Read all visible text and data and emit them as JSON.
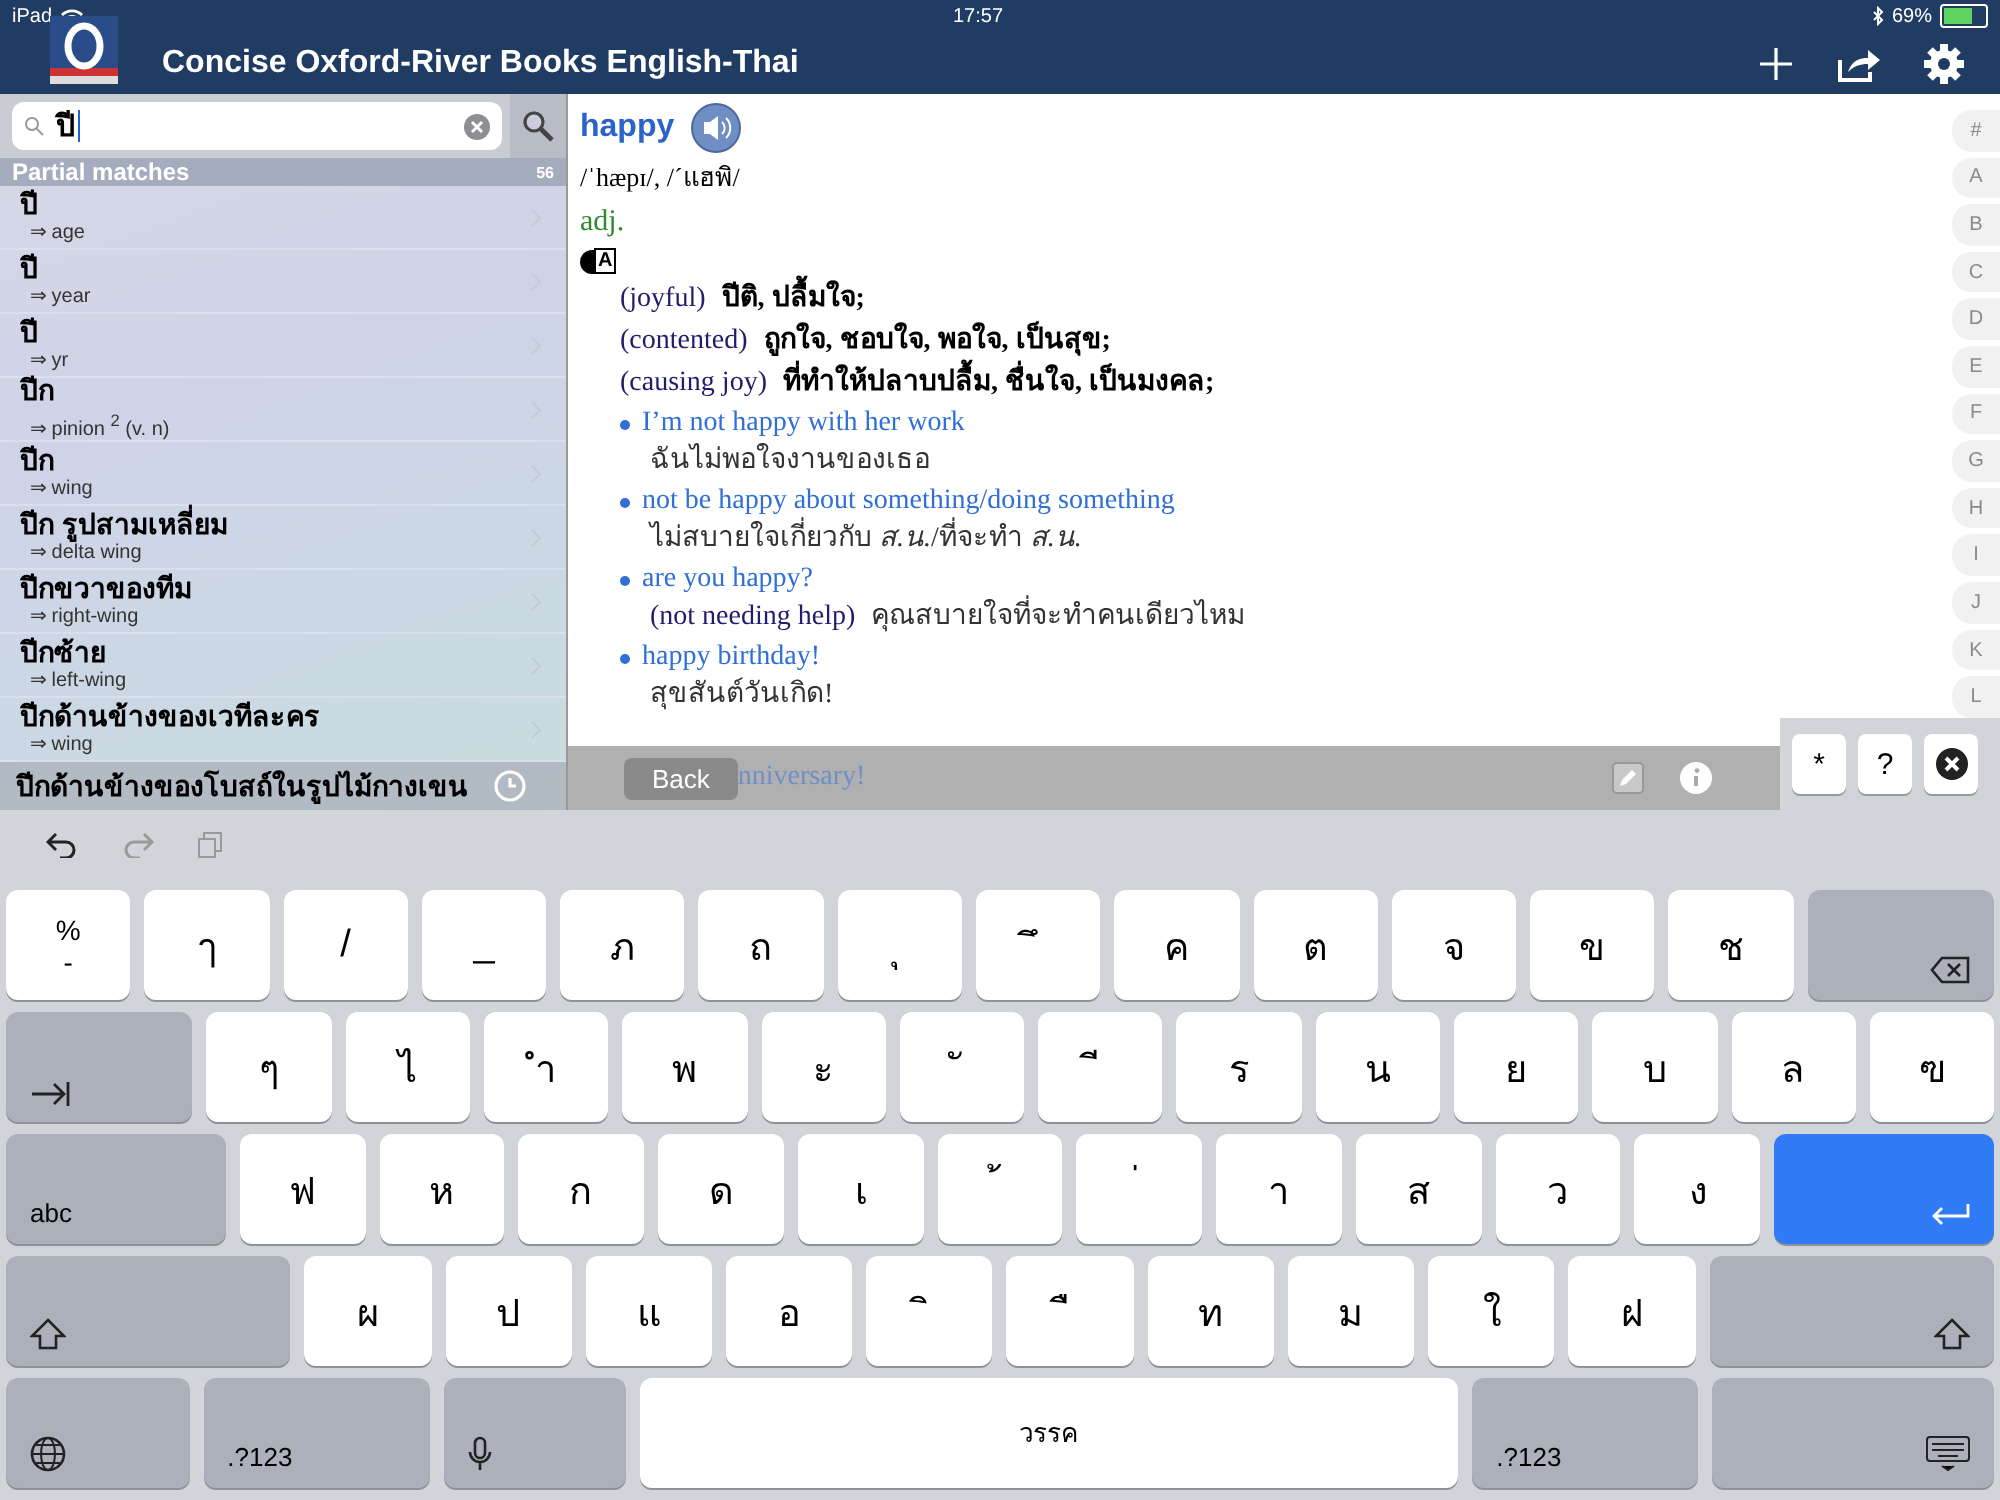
{
  "status_bar": {
    "device": "iPad",
    "time": "17:57",
    "battery": "69%"
  },
  "header": {
    "title": "Concise Oxford-River Books English-Thai"
  },
  "search": {
    "value": "ปี"
  },
  "results": {
    "heading": "Partial matches",
    "count": "56",
    "items": [
      {
        "headword": "ปี",
        "gloss": "⇒ age"
      },
      {
        "headword": "ปี",
        "gloss": "⇒ year"
      },
      {
        "headword": "ปี",
        "gloss": "⇒ yr"
      },
      {
        "headword": "ปีก",
        "gloss": "⇒ pinion $^{2}$ (v. n)"
      },
      {
        "headword": "ปีก",
        "gloss": "⇒ wing"
      },
      {
        "headword": "ปีก รูปสามเหลี่ยม",
        "gloss": "⇒ delta wing"
      },
      {
        "headword": "ปีกขวาของทีม",
        "gloss": "⇒ right-wing"
      },
      {
        "headword": "ปีกซ้าย",
        "gloss": "⇒ left-wing"
      },
      {
        "headword": "ปีกด้านข้างของเวทีละคร",
        "gloss": "⇒ wing"
      }
    ],
    "last_item": "ปีกด้านข้างของโบสถ์ในรูปไม้กางเขน"
  },
  "entry": {
    "headword": "happy",
    "pronunciation": "/ˈhæpɪ/, /ˊแฮพิ/",
    "pos": "adj.",
    "register_mark": "A",
    "senses": [
      {
        "label": "(joyful)",
        "text": "ปีติ, ปลื้มใจ;"
      },
      {
        "label": "(contented)",
        "text": "ถูกใจ, ชอบใจ, พอใจ, เป็นสุข;"
      },
      {
        "label": "(causing joy)",
        "text": "ที่ทำให้ปลาบปลื้ม, ชื่นใจ, เป็นมงคล;"
      }
    ],
    "examples": [
      {
        "text": "I’m not happy with her work",
        "translation": "ฉันไม่พอใจงานของเธอ"
      },
      {
        "text": "not be happy about something/doing something",
        "translation": "ไม่สบายใจเกี่ยวกับ *ส.น.*/ที่จะทำ *ส.น.*"
      },
      {
        "text": "are you happy?",
        "note": "(not needing help)",
        "translation": "คุณสบายใจที่จะทำคนเดียวไหม"
      },
      {
        "text": "happy birthday!",
        "translation": "สุขสันต์วันเกิด!"
      }
    ],
    "cut_example": "nniversary!"
  },
  "index_letters": [
    "#",
    "A",
    "B",
    "C",
    "D",
    "E",
    "F",
    "G",
    "H",
    "I",
    "J",
    "K",
    "L"
  ],
  "toolbar": {
    "back": "Back"
  },
  "accessory_keys": [
    {
      "kind": "char",
      "label": "*"
    },
    {
      "kind": "char",
      "label": "?"
    },
    {
      "kind": "clear"
    }
  ],
  "keyboard": {
    "rows": [
      [
        {
          "kind": "char",
          "label": "%",
          "sub": "-"
        },
        {
          "kind": "char",
          "label": "ๅ"
        },
        {
          "kind": "char",
          "label": "/"
        },
        {
          "kind": "char",
          "label": "_"
        },
        {
          "kind": "char",
          "label": "ภ"
        },
        {
          "kind": "char",
          "label": "ถ"
        },
        {
          "kind": "char",
          "label": "ุ"
        },
        {
          "kind": "char",
          "label": "ึ"
        },
        {
          "kind": "char",
          "label": "ค"
        },
        {
          "kind": "char",
          "label": "ต"
        },
        {
          "kind": "char",
          "label": "จ"
        },
        {
          "kind": "char",
          "label": "ข"
        },
        {
          "kind": "char",
          "label": "ช"
        },
        {
          "kind": "delete"
        }
      ],
      [
        {
          "kind": "tab"
        },
        {
          "kind": "char",
          "label": "ๆ"
        },
        {
          "kind": "char",
          "label": "ไ"
        },
        {
          "kind": "char",
          "label": "ำ"
        },
        {
          "kind": "char",
          "label": "พ"
        },
        {
          "kind": "char",
          "label": "ะ"
        },
        {
          "kind": "char",
          "label": "ั"
        },
        {
          "kind": "char",
          "label": "ี"
        },
        {
          "kind": "char",
          "label": "ร"
        },
        {
          "kind": "char",
          "label": "น"
        },
        {
          "kind": "char",
          "label": "ย"
        },
        {
          "kind": "char",
          "label": "บ"
        },
        {
          "kind": "char",
          "label": "ล"
        },
        {
          "kind": "char",
          "label": "ฃ"
        }
      ],
      [
        {
          "kind": "abc",
          "label": "abc"
        },
        {
          "kind": "char",
          "label": "ฟ"
        },
        {
          "kind": "char",
          "label": "ห"
        },
        {
          "kind": "char",
          "label": "ก"
        },
        {
          "kind": "char",
          "label": "ด"
        },
        {
          "kind": "char",
          "label": "เ"
        },
        {
          "kind": "char",
          "label": "้"
        },
        {
          "kind": "char",
          "label": "่"
        },
        {
          "kind": "char",
          "label": "า"
        },
        {
          "kind": "char",
          "label": "ส"
        },
        {
          "kind": "char",
          "label": "ว"
        },
        {
          "kind": "char",
          "label": "ง"
        },
        {
          "kind": "return"
        }
      ],
      [
        {
          "kind": "shift"
        },
        {
          "kind": "char",
          "label": "ผ"
        },
        {
          "kind": "char",
          "label": "ป"
        },
        {
          "kind": "char",
          "label": "แ"
        },
        {
          "kind": "char",
          "label": "อ"
        },
        {
          "kind": "char",
          "label": "ิ"
        },
        {
          "kind": "char",
          "label": "ื"
        },
        {
          "kind": "char",
          "label": "ท"
        },
        {
          "kind": "char",
          "label": "ม"
        },
        {
          "kind": "char",
          "label": "ใ"
        },
        {
          "kind": "char",
          "label": "ฝ"
        },
        {
          "kind": "shift"
        }
      ],
      [
        {
          "kind": "globe"
        },
        {
          "kind": "num",
          "label": ".?123"
        },
        {
          "kind": "mic"
        },
        {
          "kind": "space",
          "label": "วรรค"
        },
        {
          "kind": "num",
          "label": ".?123"
        },
        {
          "kind": "hide"
        }
      ]
    ]
  }
}
